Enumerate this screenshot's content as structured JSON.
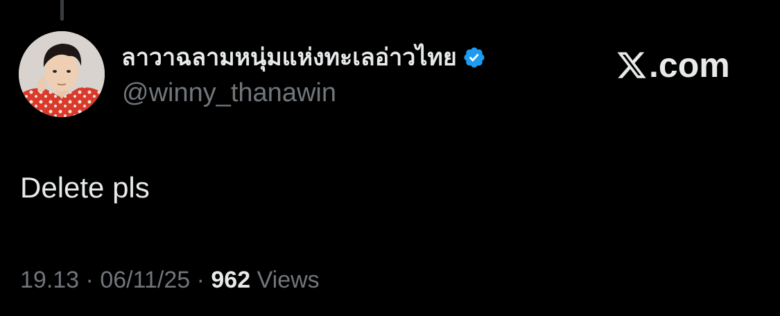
{
  "post": {
    "display_name": "ลาวาฉลามหนุ่มแห่งทะเลอ่าวไทย",
    "verified_icon": "verified-badge-icon",
    "handle": "@winny_thanawin",
    "text": "Delete pls",
    "time": "19.13",
    "separator": "·",
    "date": "06/11/25",
    "views_count": "962",
    "views_label": "Views"
  },
  "brand": {
    "icon": "x-logo-icon",
    "text": ".com"
  },
  "colors": {
    "background": "#000000",
    "primary_text": "#e7e9ea",
    "secondary_text": "#71767b",
    "verified": "#1d9bf0"
  }
}
